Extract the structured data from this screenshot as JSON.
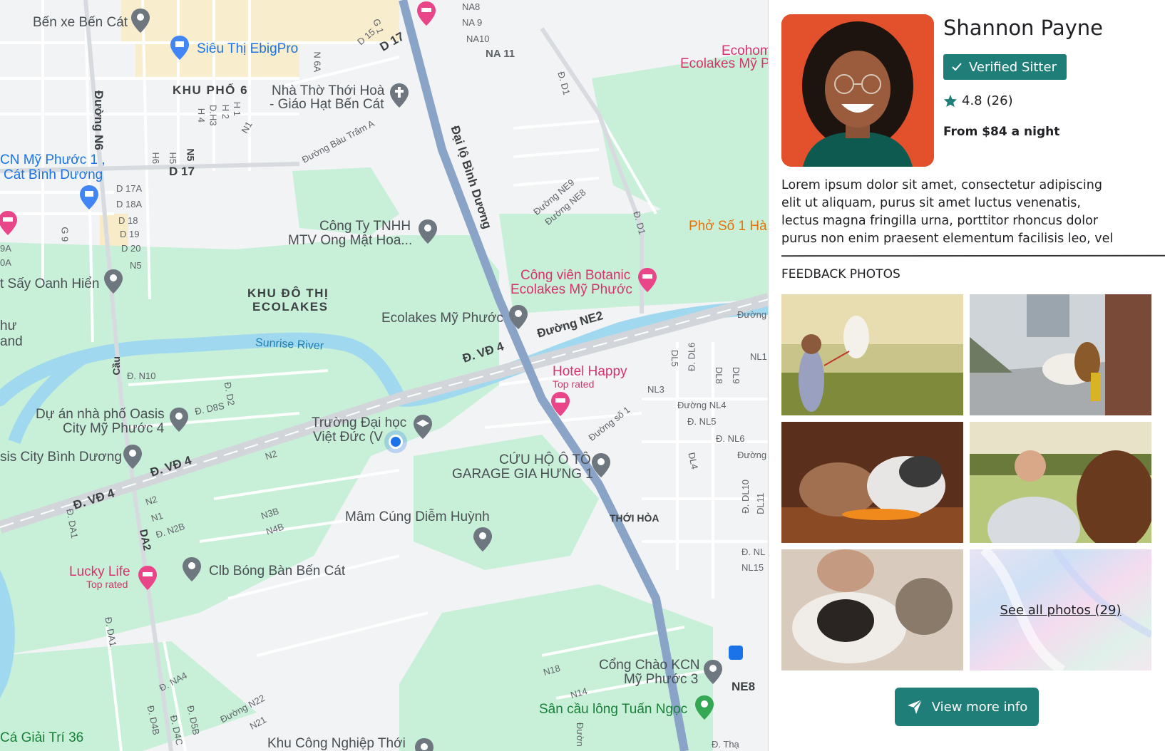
{
  "map": {
    "labels": {
      "ben_xe": "Bến xe Bến Cát",
      "sieu_thi": "Siêu Thị EbigPro",
      "khu_pho_6": "KHU PHỐ 6",
      "nha_tho_1": "Nhà Thờ Thới Hoà",
      "nha_tho_2": "- Giáo Hạt Bến Cát",
      "kcn_1": "CN Mỹ Phước 1 ,",
      "kcn_2": "Cát Bình Dương",
      "cong_ty_1": "Công Ty TNHH",
      "cong_ty_2": "MTV Ong Mật Hoa...",
      "say_oanh": "t Sấy Oanh Hiển",
      "khu_do_thi_1": "KHU ĐÔ THỊ",
      "khu_do_thi_2": "ECOLAKES",
      "ecolakes_mp": "Ecolakes Mỹ Phước",
      "cong_vien_1": "Công viên Botanic",
      "cong_vien_2": "Ecolakes Mỹ Phước",
      "ecohome_1": "Ecohom",
      "ecohome_2": "Ecolakes Mỹ P",
      "pho_so_1": "Phở Số 1 Hà",
      "sunrise_river": "Sunrise River",
      "hotel_happy": "Hotel Happy",
      "top_rated": "Top rated",
      "du_an_1": "Dự án nhà phố Oasis",
      "du_an_2": "City Mỹ Phước 4",
      "truong_1": "Trường Đại học",
      "truong_2": "Việt Đức (V",
      "oasis_bd": "sis City Bình Dương",
      "cuu_ho_1": "CỨU HỘ Ô TÔ",
      "cuu_ho_2": "GARAGE GIA HƯNG 1",
      "mam_cung": "Mâm Cúng Diễm Huỳnh",
      "thoi_hoa": "THỚI HÒA",
      "lucky_life": "Lucky Life",
      "clb": "Clb Bóng Bàn Bến Cát",
      "cong_chao_1": "Cổng Chào KCN",
      "cong_chao_2": "Mỹ Phước 3",
      "san_cau": "Sân cầu lông Tuấn Ngọc",
      "ca_giai_tri": "Cá Giải Trí 36",
      "khu_cong_nghiep": "Khu Công Nghiệp Thới",
      "ne8": "NE8",
      "thu": "hư",
      "and": "and",
      "duong_ne2": "Đường NE2",
      "d_vd4_a": "Đ. VĐ 4",
      "d_vd4_b": "Đ. VĐ 4",
      "d_vd4_c": "Đ. VĐ 4",
      "dai_lo": "Đại lộ Bình Dương",
      "duong_n6": "Đường N6",
      "d17_a": "D 17",
      "d17_b": "D 17",
      "na11": "NA 11",
      "na9": "NA 9",
      "na10": "NA10",
      "na8": "NA8",
      "d15": "D 15",
      "d16": "G 1",
      "n6a": "N 6A",
      "h4": "H 4",
      "h2": "H 2",
      "h1": "H 1",
      "dh3": "D.H3",
      "n1": "N1",
      "h5": "H5",
      "h6": "H6",
      "n5": "N5",
      "d17a": "D 17A",
      "d18a": "D 18A",
      "d18": "D 18",
      "d19": "D 19",
      "d20": "D 20",
      "n5b": "N5",
      "g9": "G 9",
      "ia9": "9A",
      "ia0": "0A",
      "bau_tram": "Đường Bàu Trâm A",
      "d_d1_a": "Đ. D1",
      "d_d1_b": "Đ. D1",
      "ne9": "Đường NE9",
      "ne8b": "Đường NE8",
      "cau": "Cầu",
      "d_n10": "Đ. N10",
      "d_d8s": "Đ. D8S",
      "d_d2": "Đ. D2",
      "n2a": "N2",
      "n2b": "N2",
      "n1b": "N1",
      "n3b": "N3B",
      "n4b": "N4B",
      "n2b2": "Đ. N2B",
      "d_da1_a": "Đ. DA1",
      "d_da1_b": "Đ. DA1",
      "da2": "DA2",
      "dl5": "DL5",
      "d_dl6": "Đ. DL6",
      "dl8": "DL8",
      "dl9": "DL9",
      "nl1": "NL1",
      "nl3": "NL3",
      "duong_nl4": "Đường NL4",
      "d_nl5": "Đ. NL5",
      "d_nl6": "Đ. NL6",
      "duong_r": "Đường",
      "duong_r2": "Đường",
      "dl4": "DL4",
      "d_dl10": "Đ. DL10",
      "dl11": "DL11",
      "d_nl": "Đ. NL",
      "nl15": "NL15",
      "duong_so1": "Đường số 1",
      "n18": "N18",
      "n14": "N14",
      "d_na4": "Đ. NA4",
      "duong_n22": "Đường N22",
      "n21": "N21",
      "d_d4b": "Đ. D4B",
      "d_d4c": "Đ. D4C",
      "d_d5b": "Đ. D5B",
      "d_th": "Đ. Thạ",
      "duong_bot": "Đườn"
    }
  },
  "sitter": {
    "name": "Shannon Payne",
    "badge": "Verified Sitter",
    "rating": "4.8",
    "reviews": "(26)",
    "price": "From $84 a night",
    "bio": "Lorem ipsum dolor sit amet, consectetur adipiscing elit ut aliquam, purus sit amet luctus venenatis, lectus magna fringilla urna, porttitor rhoncus dolor purus non enim praesent elementum facilisis leo, vel"
  },
  "photos": {
    "heading": "FEEDBACK PHOTOS",
    "see_all": "See all photos (29)"
  },
  "actions": {
    "view_more": "View more info"
  },
  "colors": {
    "accent": "#1f7f78",
    "map_green": "#c8f0d8",
    "map_water": "#9fd8ef",
    "map_road_major": "#8aa4c8",
    "poi_pink": "#d6336c"
  },
  "icons": {
    "badge": "check-icon",
    "rating": "star-icon",
    "view_more": "send-icon"
  }
}
